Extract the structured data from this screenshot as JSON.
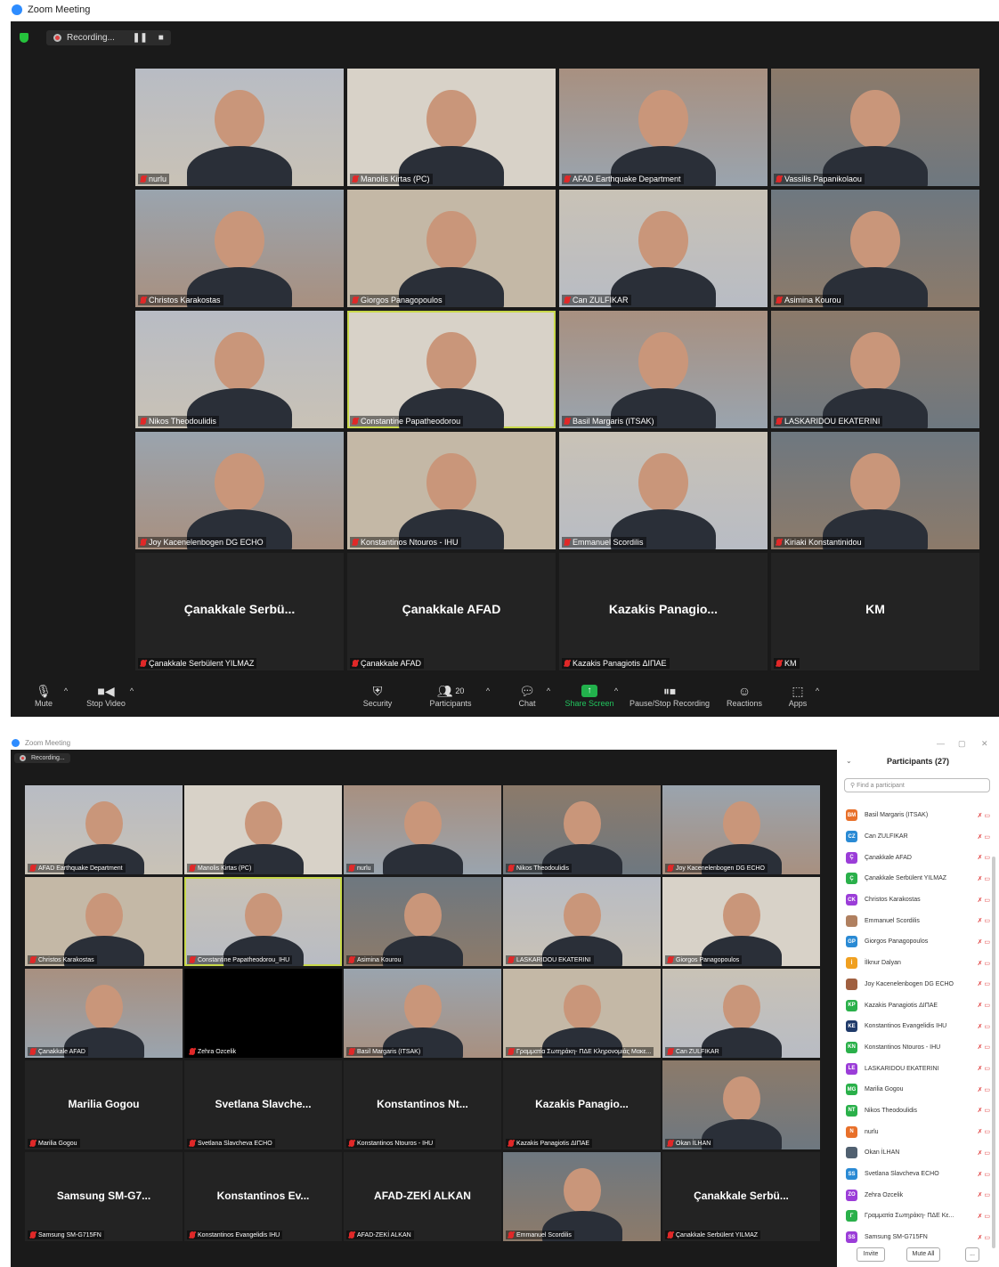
{
  "window1": {
    "title": "Zoom Meeting",
    "recording_label": "Recording...",
    "tiles": [
      {
        "name": "nurlu"
      },
      {
        "name": "Manolis Kirtas (PC)"
      },
      {
        "name": "AFAD Earthquake Department"
      },
      {
        "name": "Vassilis Papanikolaou"
      },
      {
        "name": "Christos Karakostas"
      },
      {
        "name": "Giorgos Panagopoulos"
      },
      {
        "name": "Can ZULFIKAR"
      },
      {
        "name": "Asimina Kourou"
      },
      {
        "name": "Nikos Theodoulidis"
      },
      {
        "name": "Constantine Papatheodorou"
      },
      {
        "name": "Basil Margaris (ITSAK)"
      },
      {
        "name": "LASKARIDOU EKATERINI"
      },
      {
        "name": "Joy Kacenelenbogen  DG ECHO"
      },
      {
        "name": "Konstantinos Ntouros - IHU"
      },
      {
        "name": "Emmanuel Scordilis"
      },
      {
        "name": "Kiriaki Konstantinidou"
      },
      {
        "name": "Çanakkale Serbülent YILMAZ",
        "big": "Çanakkale  Serbü..."
      },
      {
        "name": "Çanakkale AFAD",
        "big": "Çanakkale AFAD"
      },
      {
        "name": "Kazakis Panagiotis ΔΙΠΑΕ",
        "big": "Kazakis  Panagio..."
      },
      {
        "name": "KM",
        "big": "KM"
      }
    ],
    "toolbar": {
      "mute": "Mute",
      "stop_video": "Stop Video",
      "security": "Security",
      "participants": "Participants",
      "participants_count": "20",
      "chat": "Chat",
      "share_screen": "Share Screen",
      "pause_recording": "Pause/Stop Recording",
      "reactions": "Reactions",
      "apps": "Apps"
    }
  },
  "window2": {
    "title": "Zoom Meeting",
    "recording_label": "Recording...",
    "tiles": [
      {
        "name": "AFAD Earthquake Department"
      },
      {
        "name": "Manolis Kirtas (PC)"
      },
      {
        "name": "nurlu"
      },
      {
        "name": "Nikos Theodoulidis"
      },
      {
        "name": "Joy Kacenelenbogen DG ECHO"
      },
      {
        "name": "Christos Karakostas"
      },
      {
        "name": "Constantine Papatheodorou_IHU"
      },
      {
        "name": "Asimina Kourou"
      },
      {
        "name": "LASKARIDOU EKATERINI"
      },
      {
        "name": "Giorgos Panagopoulos"
      },
      {
        "name": "Çanakkale AFAD"
      },
      {
        "name": "Zehra Ozcelik"
      },
      {
        "name": "Basil Margaris (ITSAK)"
      },
      {
        "name": "Γραμματία Σωτηράκη- ΠΔΕ Κληρονομιάς Μακε..."
      },
      {
        "name": "Can ZULFIKAR"
      },
      {
        "name": "Marilia Gogou",
        "big": "Marilia Gogou"
      },
      {
        "name": "Svetlana Slavcheva ECHO",
        "big": "Svetlana  Slavche..."
      },
      {
        "name": "Konstantinos Ntouros - IHU",
        "big": "Konstantinos  Nt..."
      },
      {
        "name": "Kazakis Panagiotis ΔΙΠΑΕ",
        "big": "Kazakis  Panagio..."
      },
      {
        "name": "Okan İLHAN"
      },
      {
        "name": "Samsung SM-G715FN",
        "big": "Samsung  SM-G7..."
      },
      {
        "name": "Konstantinos Evangelidis IHU",
        "big": "Konstantinos  Ev..."
      },
      {
        "name": "AFAD-ZEKİ ALKAN",
        "big": "AFAD-ZEKİ ALKAN"
      },
      {
        "name": "Emmanuel Scordilis"
      },
      {
        "name": "Çanakkale Serbülent YILMAZ",
        "big": "Çanakkale  Serbü..."
      }
    ],
    "panel": {
      "title": "Participants (27)",
      "search_placeholder": "Find a participant",
      "invite": "Invite",
      "mute_all": "Mute All",
      "more": "...",
      "participants": [
        {
          "initials": "BM",
          "name": "Basil Margaris (ITSAK)",
          "color": "#e8702a"
        },
        {
          "initials": "CZ",
          "name": "Can ZULFIKAR",
          "color": "#2a8ad4"
        },
        {
          "initials": "Ç",
          "name": "Çanakkale AFAD",
          "color": "#9b3dd8"
        },
        {
          "initials": "Ç",
          "name": "Çanakkale Serbülent YILMAZ",
          "color": "#2ab04a"
        },
        {
          "initials": "CK",
          "name": "Christos Karakostas",
          "color": "#9b3dd8"
        },
        {
          "initials": "",
          "name": "Emmanuel Scordilis",
          "color": "#b08060"
        },
        {
          "initials": "GP",
          "name": "Giorgos Panagopoulos",
          "color": "#2a8ad4"
        },
        {
          "initials": "İ",
          "name": "İlknur Dalyan",
          "color": "#f0a020"
        },
        {
          "initials": "",
          "name": "Joy Kacenelenbogen DG ECHO",
          "color": "#a06040"
        },
        {
          "initials": "KP",
          "name": "Kazakis Panagiotis ΔΙΠΑΕ",
          "color": "#2ab04a"
        },
        {
          "initials": "KE",
          "name": "Konstantinos Evangelidis IHU",
          "color": "#1f3a6a"
        },
        {
          "initials": "KN",
          "name": "Konstantinos Ntouros - IHU",
          "color": "#2ab04a"
        },
        {
          "initials": "LE",
          "name": "LASKARIDOU EKATERINI",
          "color": "#9b3dd8"
        },
        {
          "initials": "MG",
          "name": "Marilia Gogou",
          "color": "#2ab04a"
        },
        {
          "initials": "NT",
          "name": "Nikos Theodoulidis",
          "color": "#2ab04a"
        },
        {
          "initials": "N",
          "name": "nurlu",
          "color": "#e8702a"
        },
        {
          "initials": "",
          "name": "Okan İLHAN",
          "color": "#506070"
        },
        {
          "initials": "SS",
          "name": "Svetlana Slavcheva ECHO",
          "color": "#2a8ad4"
        },
        {
          "initials": "ZO",
          "name": "Zehra Ozcelik",
          "color": "#9b3dd8"
        },
        {
          "initials": "Γ",
          "name": "Γραμματία Σωτηράκη- ΠΔΕ Κε...",
          "color": "#2ab04a"
        },
        {
          "initials": "SS",
          "name": "Samsung SM-G715FN",
          "color": "#9b3dd8"
        }
      ]
    }
  }
}
